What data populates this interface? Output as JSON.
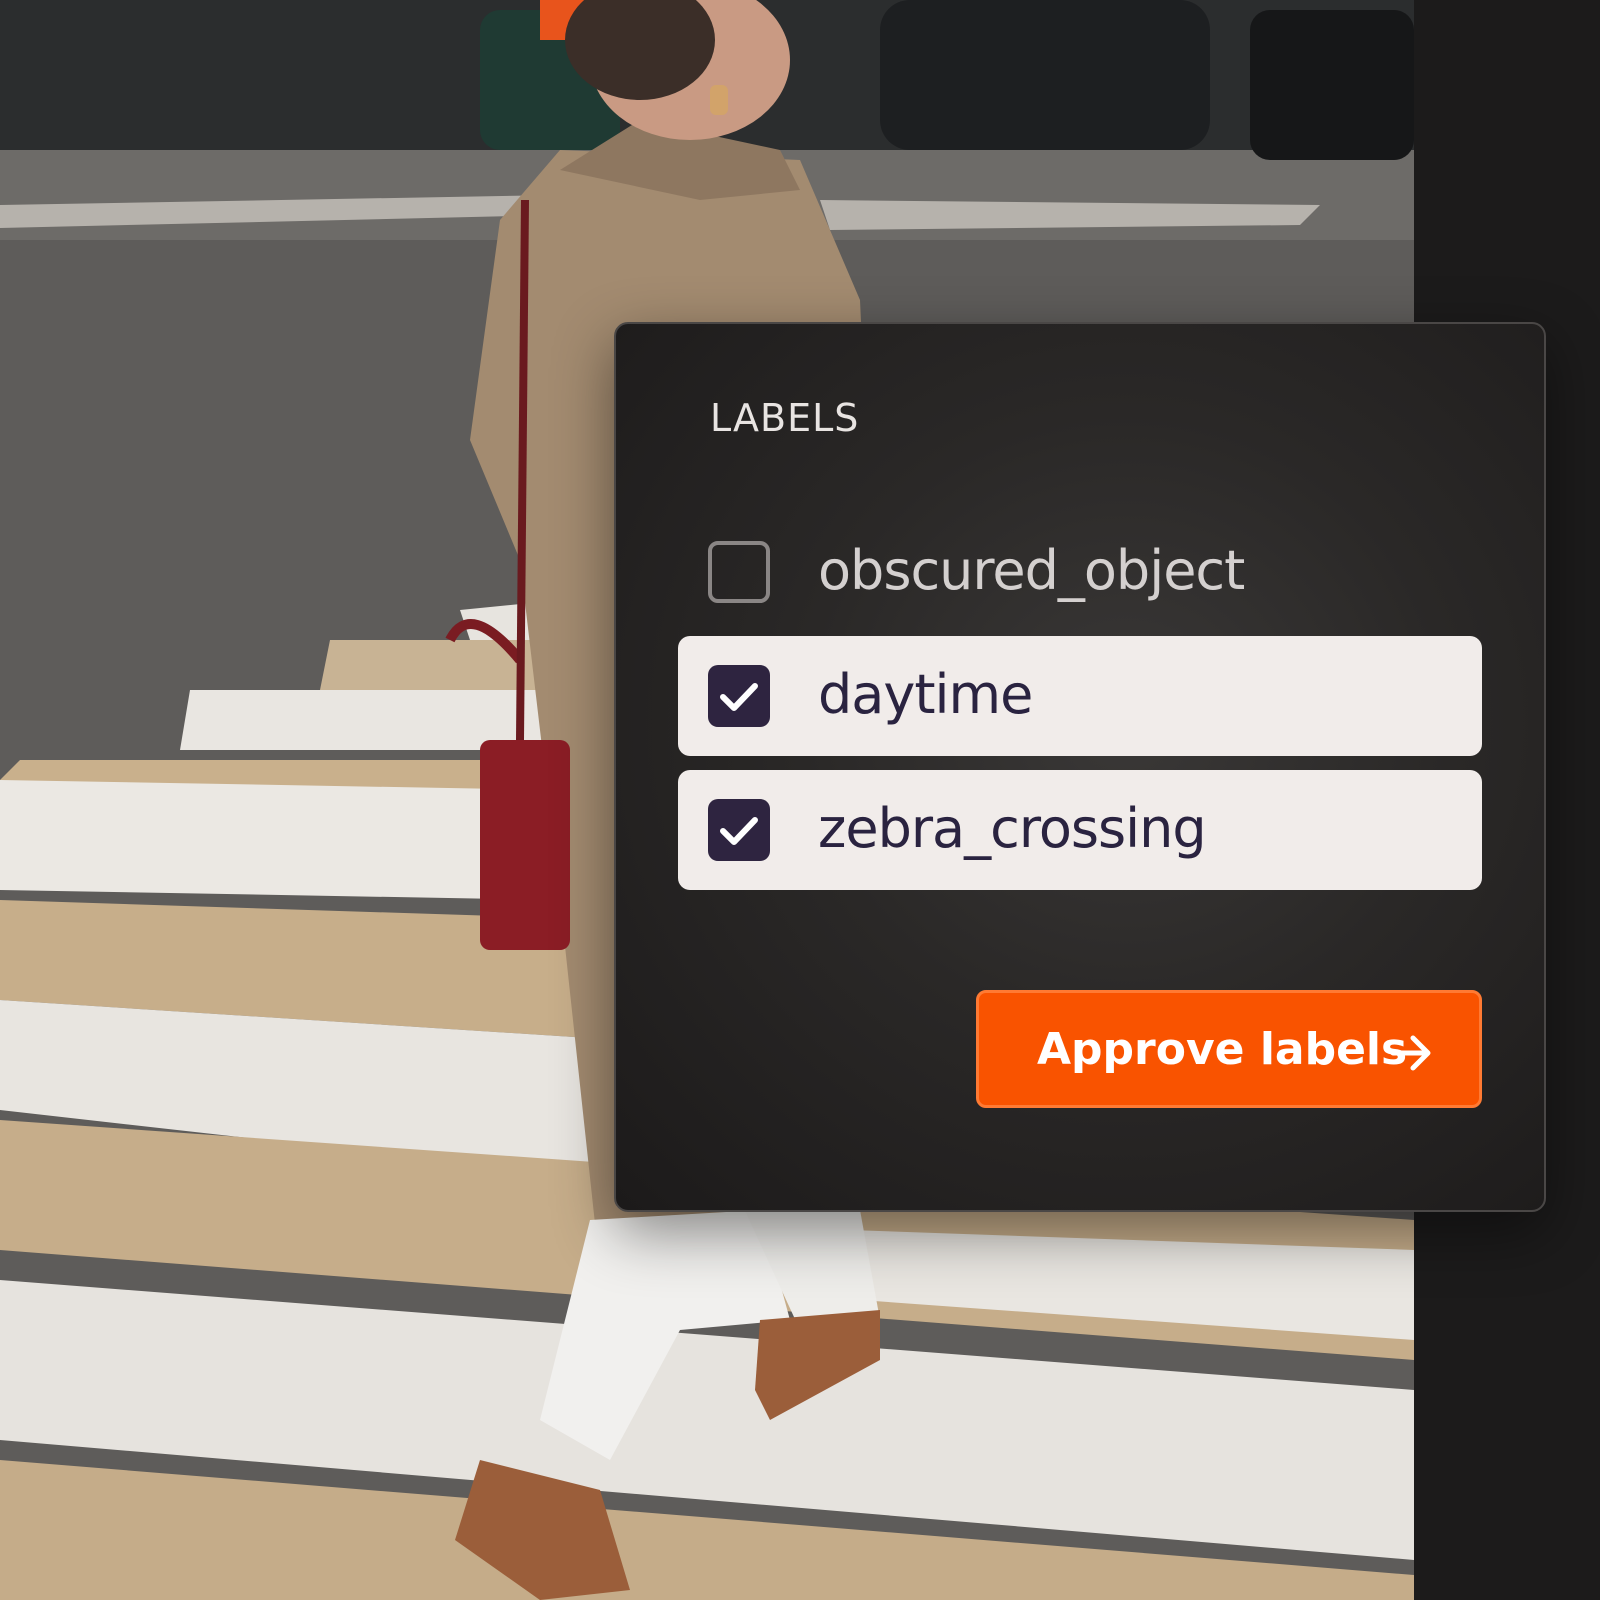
{
  "panel": {
    "title": "LABELS",
    "labels": [
      {
        "name": "obscured_object",
        "checked": false
      },
      {
        "name": "daytime",
        "checked": true
      },
      {
        "name": "zebra_crossing",
        "checked": true
      }
    ],
    "approve_button": {
      "label": "Approve labels",
      "icon": "arrow-right-icon"
    }
  },
  "colors": {
    "accent": "#f95300",
    "checkbox_checked": "#2e2440",
    "row_checked_bg": "#f1ecea",
    "panel_bg": "#2a2827"
  }
}
